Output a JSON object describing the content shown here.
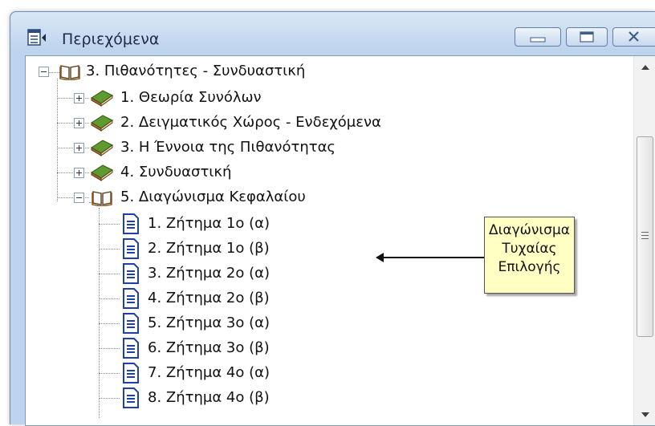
{
  "window": {
    "title": "Περιεχόμενα"
  },
  "tree": {
    "root": {
      "label": "3.  Πιθανότητες - Συνδυαστική",
      "icon": "open-book-icon",
      "expanded": true
    },
    "chapters": [
      {
        "label": "1.  Θεωρία Συνόλων",
        "icon": "book-icon",
        "expanded": false
      },
      {
        "label": "2.  Δειγματικός Χώρος - Ενδεχόμενα",
        "icon": "book-icon",
        "expanded": false
      },
      {
        "label": "3.  Η Έννοια της Πιθανότητας",
        "icon": "book-icon",
        "expanded": false
      },
      {
        "label": "4.  Συνδυαστική",
        "icon": "book-icon",
        "expanded": false
      },
      {
        "label": "5.  Διαγώνισμα Κεφαλαίου",
        "icon": "open-book-icon",
        "expanded": true
      }
    ],
    "pages": [
      {
        "label": "1. Ζήτημα 1ο (α)"
      },
      {
        "label": "2. Ζήτημα 1ο (β)"
      },
      {
        "label": "3. Ζήτημα 2ο (α)"
      },
      {
        "label": "4. Ζήτημα 2ο (β)"
      },
      {
        "label": "5. Ζήτημα 3ο (α)"
      },
      {
        "label": "6. Ζήτημα 3ο (β)"
      },
      {
        "label": "7. Ζήτημα 4ο (α)"
      },
      {
        "label": "8. Ζήτημα 4ο (β)"
      }
    ]
  },
  "callout": {
    "line1": "Διαγώνισμα",
    "line2": "Τυχαίας",
    "line3": "Επιλογής"
  },
  "colors": {
    "titlebar": "#bcd4ee",
    "book_green": "#4a8a2c",
    "book_brown": "#8a5a2b",
    "page_blue": "#1e3fae",
    "callout_bg": "#ffffc4"
  }
}
